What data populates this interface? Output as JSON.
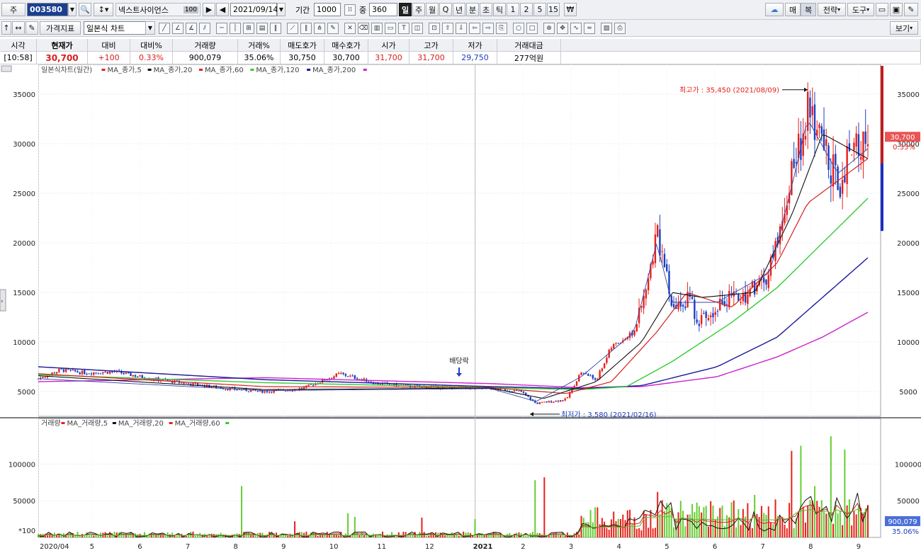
{
  "toolbar": {
    "market": "주",
    "code": "003580",
    "name": "넥스트사이언스",
    "name_badge": "100",
    "date": "2021/09/14",
    "period_label": "기간",
    "period_value": "1000",
    "count_label": "중",
    "count_value": "360",
    "intervals": [
      "일",
      "주",
      "월",
      "Q",
      "년",
      "분",
      "초",
      "틱",
      "1",
      "2",
      "5",
      "15"
    ],
    "active_interval": "일",
    "currency_symbol": "₩",
    "right_buttons": [
      "매",
      "복",
      "전략",
      "도구"
    ],
    "indicator_button": "가격지표",
    "chart_type_select": "일본식 차트",
    "view_button": "보기"
  },
  "quote": {
    "headers": [
      "시각",
      "현재가",
      "대비",
      "대비%",
      "거래량",
      "거래%",
      "매도호가",
      "매수호가",
      "시가",
      "고가",
      "저가",
      "거래대금"
    ],
    "values": [
      "[10:58]",
      "30,700",
      "+100",
      "0.33%",
      "900,079",
      "35.06%",
      "30,750",
      "30,700",
      "31,700",
      "31,700",
      "29,750",
      "277억원"
    ]
  },
  "price_chart": {
    "legend_title": "일본식차트(일간)",
    "legend_items": [
      {
        "label": "MA_종가,5",
        "color": "#e8201a"
      },
      {
        "label": "MA_종가,20",
        "color": "#111111"
      },
      {
        "label": "MA_종가,60",
        "color": "#e8201a"
      },
      {
        "label": "MA_종가,120",
        "color": "#33cc33"
      },
      {
        "label": "MA_종가,200",
        "color": "#1a1aaa"
      }
    ],
    "high_annotation": "최고가 : 35,450 (2021/08/09)",
    "low_annotation": "최저가 : 3,580 (2021/02/16)",
    "dividend_label": "배당락",
    "current_price_label": "30,700",
    "current_change_label": "0.33%"
  },
  "volume_chart": {
    "legend_title": "거래량",
    "legend_items": [
      {
        "label": "MA_거래량,5",
        "color": "#e8201a"
      },
      {
        "label": "MA_거래량,20",
        "color": "#111111"
      },
      {
        "label": "MA_거래량,60",
        "color": "#e8201a"
      }
    ],
    "multiplier_label": "*100",
    "current_volume_label": "900,079",
    "current_volume_pct": "35.06%"
  },
  "colors": {
    "up": "#e8201a",
    "down": "#1d3fbf",
    "ma5": "#e8201a",
    "ma20": "#111111",
    "ma60": "#d41f1f",
    "ma120": "#33cc33",
    "ma200": "#1a1a99",
    "ma_extra": "#cc22cc",
    "vol_up": "#e8201a",
    "vol_down": "#66cc33"
  },
  "chart_data": {
    "type": "candlestick",
    "price_axis": {
      "ticks": [
        5000,
        10000,
        15000,
        20000,
        25000,
        30000,
        35000
      ],
      "range": [
        2500,
        38000
      ]
    },
    "volume_axis": {
      "ticks": [
        50000,
        100000
      ],
      "range": [
        0,
        140000
      ],
      "unit_multiplier": 100
    },
    "time_axis_labels": [
      "2020/04",
      "5",
      "6",
      "7",
      "8",
      "9",
      "10",
      "11",
      "12",
      "2021",
      "2",
      "3",
      "4",
      "5",
      "6",
      "7",
      "8",
      "9"
    ],
    "price_anchors": [
      {
        "t": 0,
        "v": 6300
      },
      {
        "t": 0.03,
        "v": 7200
      },
      {
        "t": 0.06,
        "v": 6900
      },
      {
        "t": 0.1,
        "v": 7000
      },
      {
        "t": 0.15,
        "v": 6300
      },
      {
        "t": 0.2,
        "v": 5800
      },
      {
        "t": 0.25,
        "v": 5300
      },
      {
        "t": 0.3,
        "v": 5000
      },
      {
        "t": 0.35,
        "v": 5300
      },
      {
        "t": 0.4,
        "v": 6800
      },
      {
        "t": 0.45,
        "v": 5800
      },
      {
        "t": 0.5,
        "v": 5500
      },
      {
        "t": 0.55,
        "v": 5400
      },
      {
        "t": 0.6,
        "v": 5300
      },
      {
        "t": 0.64,
        "v": 5000
      },
      {
        "t": 0.66,
        "v": 3800
      },
      {
        "t": 0.7,
        "v": 4200
      },
      {
        "t": 0.72,
        "v": 7000
      },
      {
        "t": 0.74,
        "v": 6200
      },
      {
        "t": 0.76,
        "v": 9500
      },
      {
        "t": 0.79,
        "v": 11000
      },
      {
        "t": 0.81,
        "v": 16000
      },
      {
        "t": 0.82,
        "v": 21500
      },
      {
        "t": 0.83,
        "v": 18000
      },
      {
        "t": 0.84,
        "v": 13000
      },
      {
        "t": 0.86,
        "v": 14500
      },
      {
        "t": 0.88,
        "v": 12000
      },
      {
        "t": 0.9,
        "v": 14000
      },
      {
        "t": 0.93,
        "v": 14500
      },
      {
        "t": 0.95,
        "v": 15500
      },
      {
        "t": 0.97,
        "v": 17000
      },
      {
        "t": 0.985,
        "v": 22000
      },
      {
        "t": 1.0,
        "v": 27500
      },
      {
        "t": 1.02,
        "v": 33000
      },
      {
        "t": 1.04,
        "v": 30000
      },
      {
        "t": 1.06,
        "v": 26000
      },
      {
        "t": 1.08,
        "v": 29000
      },
      {
        "t": 1.1,
        "v": 30700
      }
    ],
    "ma5_anchors": [
      {
        "t": 0,
        "v": 6300
      },
      {
        "t": 0.3,
        "v": 5100
      },
      {
        "t": 0.6,
        "v": 5300
      },
      {
        "t": 0.66,
        "v": 4000
      },
      {
        "t": 0.72,
        "v": 6500
      },
      {
        "t": 0.79,
        "v": 11000
      },
      {
        "t": 0.82,
        "v": 20000
      },
      {
        "t": 0.84,
        "v": 14000
      },
      {
        "t": 0.9,
        "v": 14000
      },
      {
        "t": 0.97,
        "v": 17000
      },
      {
        "t": 1.0,
        "v": 26000
      },
      {
        "t": 1.02,
        "v": 32500
      },
      {
        "t": 1.06,
        "v": 27000
      },
      {
        "t": 1.1,
        "v": 29500
      }
    ],
    "ma20_anchors": [
      {
        "t": 0,
        "v": 6600
      },
      {
        "t": 0.3,
        "v": 5200
      },
      {
        "t": 0.6,
        "v": 5350
      },
      {
        "t": 0.67,
        "v": 4300
      },
      {
        "t": 0.74,
        "v": 6000
      },
      {
        "t": 0.8,
        "v": 10000
      },
      {
        "t": 0.84,
        "v": 15000
      },
      {
        "t": 0.88,
        "v": 14500
      },
      {
        "t": 0.95,
        "v": 15000
      },
      {
        "t": 1.0,
        "v": 23000
      },
      {
        "t": 1.04,
        "v": 31000
      },
      {
        "t": 1.1,
        "v": 28500
      }
    ],
    "ma60_anchors": [
      {
        "t": 0,
        "v": 6800
      },
      {
        "t": 0.3,
        "v": 5500
      },
      {
        "t": 0.6,
        "v": 5400
      },
      {
        "t": 0.7,
        "v": 4800
      },
      {
        "t": 0.76,
        "v": 6000
      },
      {
        "t": 0.82,
        "v": 11000
      },
      {
        "t": 0.86,
        "v": 15000
      },
      {
        "t": 0.92,
        "v": 13500
      },
      {
        "t": 0.98,
        "v": 18000
      },
      {
        "t": 1.02,
        "v": 24000
      },
      {
        "t": 1.1,
        "v": 28500
      }
    ],
    "ma120_anchors": [
      {
        "t": 0,
        "v": 6700
      },
      {
        "t": 0.3,
        "v": 5900
      },
      {
        "t": 0.6,
        "v": 5400
      },
      {
        "t": 0.72,
        "v": 5200
      },
      {
        "t": 0.78,
        "v": 5500
      },
      {
        "t": 0.84,
        "v": 8000
      },
      {
        "t": 0.92,
        "v": 12000
      },
      {
        "t": 0.98,
        "v": 15500
      },
      {
        "t": 1.04,
        "v": 20000
      },
      {
        "t": 1.1,
        "v": 24500
      }
    ],
    "ma200_anchors": [
      {
        "t": 0,
        "v": 7500
      },
      {
        "t": 0.3,
        "v": 6200
      },
      {
        "t": 0.6,
        "v": 5500
      },
      {
        "t": 0.72,
        "v": 5300
      },
      {
        "t": 0.8,
        "v": 5600
      },
      {
        "t": 0.9,
        "v": 7500
      },
      {
        "t": 0.98,
        "v": 10500
      },
      {
        "t": 1.04,
        "v": 14500
      },
      {
        "t": 1.1,
        "v": 18500
      }
    ],
    "maextra_anchors": [
      {
        "t": 0,
        "v": 6000
      },
      {
        "t": 0.3,
        "v": 6400
      },
      {
        "t": 0.6,
        "v": 5800
      },
      {
        "t": 0.72,
        "v": 5400
      },
      {
        "t": 0.8,
        "v": 5500
      },
      {
        "t": 0.9,
        "v": 6500
      },
      {
        "t": 0.98,
        "v": 8500
      },
      {
        "t": 1.04,
        "v": 10500
      },
      {
        "t": 1.1,
        "v": 13000
      }
    ],
    "volume_spikes": [
      {
        "t": 0.27,
        "v": 70000
      },
      {
        "t": 0.34,
        "v": 22000
      },
      {
        "t": 0.41,
        "v": 33000
      },
      {
        "t": 0.42,
        "v": 28000
      },
      {
        "t": 0.51,
        "v": 27000
      },
      {
        "t": 0.58,
        "v": 25000
      },
      {
        "t": 0.66,
        "v": 78000
      },
      {
        "t": 0.67,
        "v": 82000
      },
      {
        "t": 0.74,
        "v": 41000
      },
      {
        "t": 0.78,
        "v": 37000
      },
      {
        "t": 0.82,
        "v": 62000
      },
      {
        "t": 0.84,
        "v": 40000
      },
      {
        "t": 0.88,
        "v": 34000
      },
      {
        "t": 0.92,
        "v": 48000
      },
      {
        "t": 0.95,
        "v": 58000
      },
      {
        "t": 1.0,
        "v": 118000
      },
      {
        "t": 1.01,
        "v": 125000
      },
      {
        "t": 1.03,
        "v": 70000
      },
      {
        "t": 1.05,
        "v": 138000
      },
      {
        "t": 1.07,
        "v": 120000
      },
      {
        "t": 1.09,
        "v": 40000
      }
    ]
  }
}
